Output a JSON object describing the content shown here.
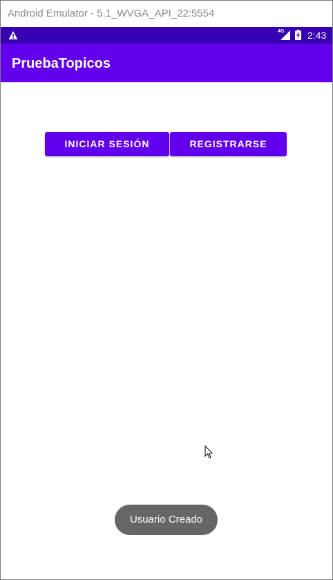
{
  "window": {
    "title": "Android Emulator - 5.1_WVGA_API_22:5554"
  },
  "status_bar": {
    "network": "4G",
    "time": "2:43",
    "icons": [
      "warning-icon",
      "signal-icon",
      "battery-icon"
    ],
    "color": "#3700b3"
  },
  "app_bar": {
    "title": "PruebaTopicos",
    "color": "#6200ee"
  },
  "buttons": {
    "login_label": "INICIAR SESIÓN",
    "register_label": "REGISTRARSE"
  },
  "toast": {
    "message": "Usuario Creado"
  }
}
